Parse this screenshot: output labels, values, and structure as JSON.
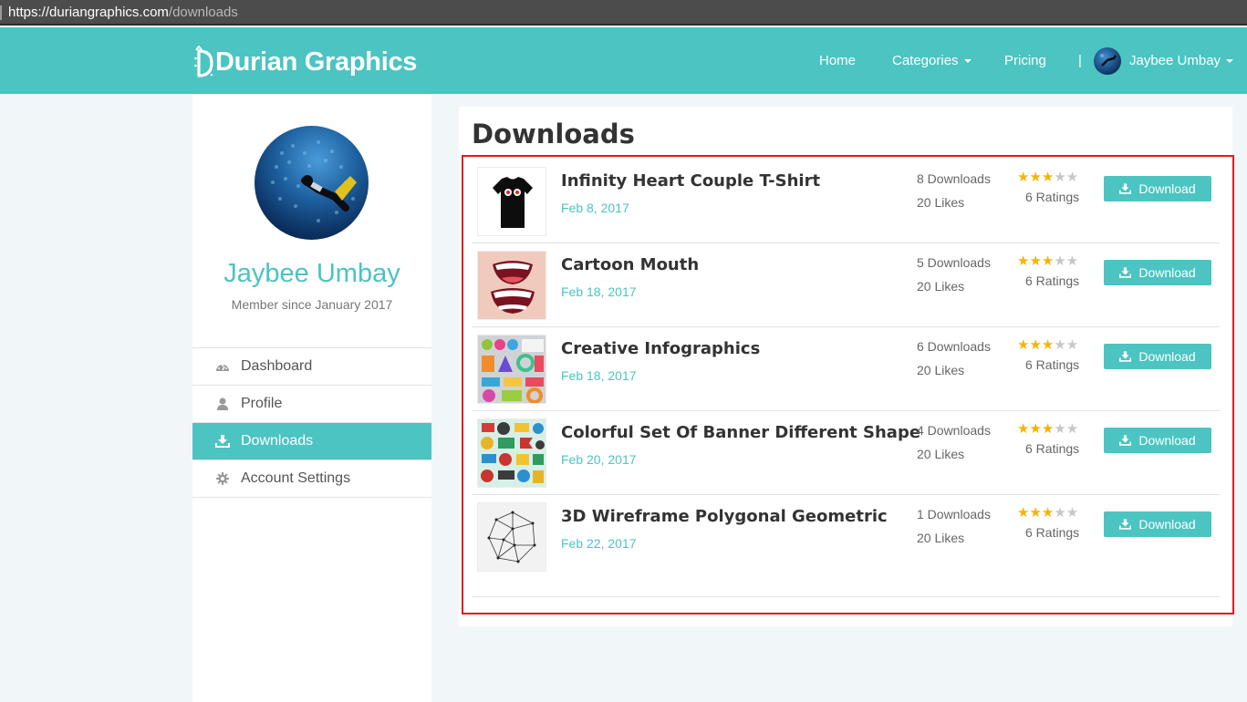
{
  "browser": {
    "url_host": "https://duriangraphics.com",
    "url_path": "/downloads"
  },
  "brand": {
    "name": "Durian Graphics"
  },
  "nav": {
    "home": "Home",
    "categories": "Categories",
    "pricing": "Pricing",
    "separator": "|",
    "user": "Jaybee Umbay"
  },
  "profile": {
    "name": "Jaybee Umbay",
    "since": "Member since January 2017"
  },
  "menu": [
    {
      "label": "Dashboard",
      "icon": "dashboard-icon"
    },
    {
      "label": "Profile",
      "icon": "user-icon"
    },
    {
      "label": "Downloads",
      "icon": "download-icon",
      "active": true
    },
    {
      "label": "Account Settings",
      "icon": "gear-icon"
    }
  ],
  "page": {
    "title": "Downloads"
  },
  "colors": {
    "accent": "#4bc4c2",
    "star": "#f5b400",
    "highlight": "#e21b1b"
  },
  "items": [
    {
      "title": "Infinity Heart Couple T-Shirt",
      "date": "Feb 8, 2017",
      "downloads": "8 Downloads",
      "likes": "20 Likes",
      "rating": 3,
      "ratings": "6 Ratings",
      "button": "Download"
    },
    {
      "title": "Cartoon Mouth",
      "date": "Feb 18, 2017",
      "downloads": "5 Downloads",
      "likes": "20 Likes",
      "rating": 3,
      "ratings": "6 Ratings",
      "button": "Download"
    },
    {
      "title": "Creative Infographics",
      "date": "Feb 18, 2017",
      "downloads": "6 Downloads",
      "likes": "20 Likes",
      "rating": 3,
      "ratings": "6 Ratings",
      "button": "Download"
    },
    {
      "title": "Colorful Set Of Banner Different Shape",
      "date": "Feb 20, 2017",
      "downloads": "4 Downloads",
      "likes": "20 Likes",
      "rating": 3,
      "ratings": "6 Ratings",
      "button": "Download"
    },
    {
      "title": "3D Wireframe Polygonal Geometric",
      "date": "Feb 22, 2017",
      "downloads": "1 Downloads",
      "likes": "20 Likes",
      "rating": 3,
      "ratings": "6 Ratings",
      "button": "Download"
    }
  ]
}
